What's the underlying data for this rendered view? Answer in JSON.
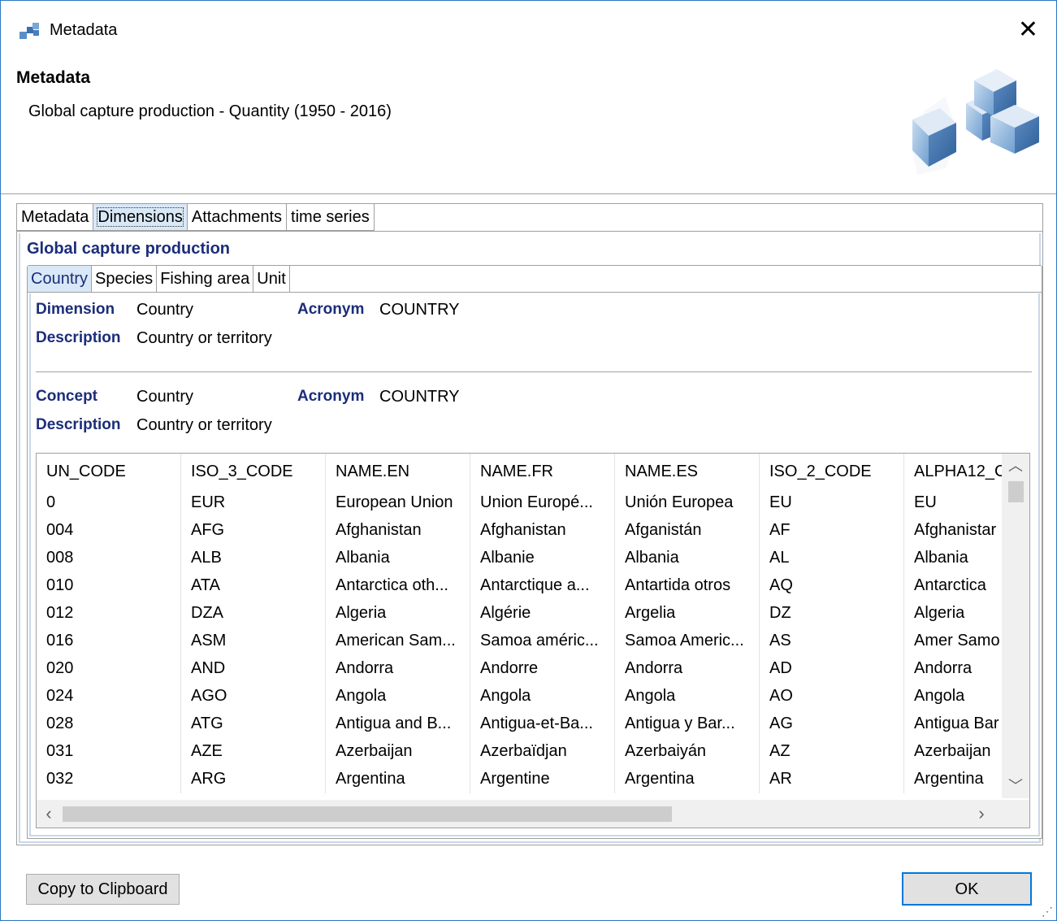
{
  "window": {
    "title": "Metadata",
    "close_icon": "close-icon"
  },
  "header": {
    "title": "Metadata",
    "subtitle": "Global capture production - Quantity (1950 - 2016)"
  },
  "tabs": [
    "Metadata",
    "Dimensions",
    "Attachments",
    "time series"
  ],
  "active_tab": "Dimensions",
  "group_title": "Global capture production",
  "subtabs": [
    "Country",
    "Species",
    "Fishing area",
    "Unit"
  ],
  "active_subtab": "Country",
  "dimension": {
    "dimension_label": "Dimension",
    "dimension_value": "Country",
    "acronym_label": "Acronym",
    "acronym_value": "COUNTRY",
    "description_label": "Description",
    "description_value": "Country or territory"
  },
  "concept": {
    "concept_label": "Concept",
    "concept_value": "Country",
    "acronym_label": "Acronym",
    "acronym_value": "COUNTRY",
    "description_label": "Description",
    "description_value": "Country or territory"
  },
  "table": {
    "columns": [
      "UN_CODE",
      "ISO_3_CODE",
      "NAME.EN",
      "NAME.FR",
      "NAME.ES",
      "ISO_2_CODE",
      "ALPHA12_C"
    ],
    "rows": [
      [
        "0",
        "EUR",
        "European Union",
        "Union Europé...",
        "Unión Europea",
        "EU",
        "EU"
      ],
      [
        "004",
        "AFG",
        "Afghanistan",
        "Afghanistan",
        "Afganistán",
        "AF",
        "Afghanistar"
      ],
      [
        "008",
        "ALB",
        "Albania",
        "Albanie",
        "Albania",
        "AL",
        "Albania"
      ],
      [
        "010",
        "ATA",
        "Antarctica oth...",
        "Antarctique a...",
        "Antartida otros",
        "AQ",
        "Antarctica"
      ],
      [
        "012",
        "DZA",
        "Algeria",
        "Algérie",
        "Argelia",
        "DZ",
        "Algeria"
      ],
      [
        "016",
        "ASM",
        "American Sam...",
        "Samoa améric...",
        "Samoa Americ...",
        "AS",
        "Amer Samo"
      ],
      [
        "020",
        "AND",
        "Andorra",
        "Andorre",
        "Andorra",
        "AD",
        "Andorra"
      ],
      [
        "024",
        "AGO",
        "Angola",
        "Angola",
        "Angola",
        "AO",
        "Angola"
      ],
      [
        "028",
        "ATG",
        "Antigua and B...",
        "Antigua-et-Ba...",
        "Antigua y Bar...",
        "AG",
        "Antigua Bar"
      ],
      [
        "031",
        "AZE",
        "Azerbaijan",
        "Azerbaïdjan",
        "Azerbaiyán",
        "AZ",
        "Azerbaijan"
      ],
      [
        "032",
        "ARG",
        "Argentina",
        "Argentine",
        "Argentina",
        "AR",
        "Argentina"
      ]
    ]
  },
  "buttons": {
    "copy": "Copy to Clipboard",
    "ok": "OK"
  }
}
